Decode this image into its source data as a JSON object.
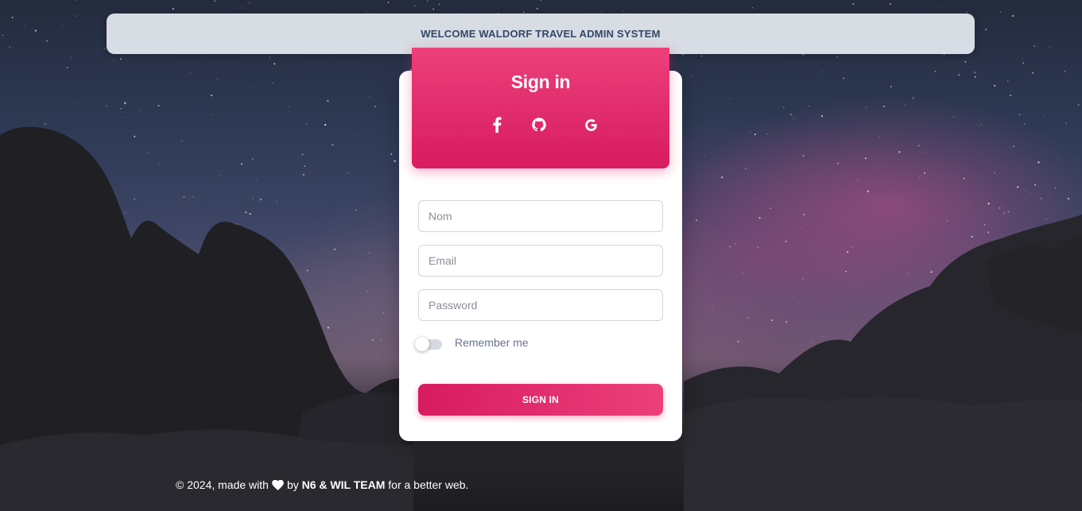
{
  "banner": {
    "text": "WELCOME WALDORF TRAVEL ADMIN SYSTEM"
  },
  "card": {
    "title": "Sign in",
    "social": [
      {
        "icon": "facebook-icon"
      },
      {
        "icon": "github-icon"
      },
      {
        "icon": "google-icon"
      }
    ]
  },
  "form": {
    "name_placeholder": "Nom",
    "email_placeholder": "Email",
    "password_placeholder": "Password",
    "remember_label": "Remember me",
    "remember_checked": false,
    "submit_label": "SIGN IN"
  },
  "footer": {
    "prefix": "© 2024, made with",
    "by": "by",
    "team": "N6 & WIL TEAM",
    "suffix": "for a better web."
  },
  "colors": {
    "accent": "#e91e63",
    "banner_text": "#344767"
  }
}
